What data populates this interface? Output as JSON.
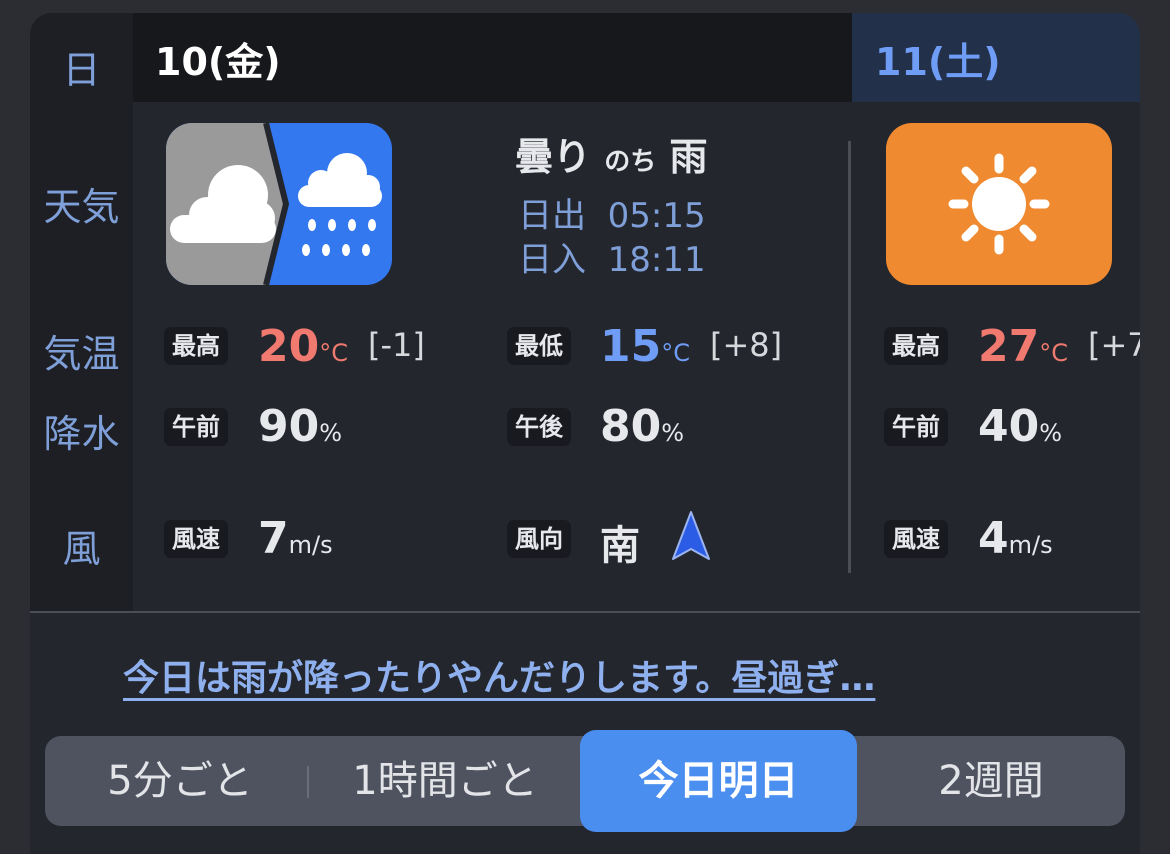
{
  "labels": {
    "day": "日",
    "weather": "天気",
    "temp": "気温",
    "precip": "降水",
    "wind": "風"
  },
  "days": [
    {
      "date": "10(金)",
      "weather_icon": "cloud-then-rain-icon",
      "forecast": {
        "first": "曇り",
        "then": "のち",
        "second": "雨"
      },
      "sunrise_label": "日出",
      "sunrise": "05:15",
      "sunset_label": "日入",
      "sunset": "18:11",
      "high_label": "最高",
      "high": "20",
      "high_unit": "°C",
      "high_diff": "[-1]",
      "low_label": "最低",
      "low": "15",
      "low_unit": "°C",
      "low_diff": "[+8]",
      "am_label": "午前",
      "am_precip": "90",
      "pm_label": "午後",
      "pm_precip": "80",
      "precip_unit": "%",
      "wind_speed_label": "風速",
      "wind_speed": "7",
      "wind_unit": "m/s",
      "wind_dir_label": "風向",
      "wind_dir": "南"
    },
    {
      "date": "11(土)",
      "weather_icon": "sun-icon",
      "high_label": "最高",
      "high": "27",
      "high_unit": "°C",
      "high_diff": "[+7",
      "am_label": "午前",
      "am_precip": "40",
      "precip_unit": "%",
      "wind_speed_label": "風速",
      "wind_speed": "4",
      "wind_unit": "m/s"
    }
  ],
  "summary_link": "今日は雨が降ったりやんだりします。昼過ぎ…",
  "tabs": [
    "5分ごと",
    "1時間ごと",
    "今日明日",
    "2週間"
  ],
  "active_tab": "今日明日",
  "colors": {
    "high": "#f07a6f",
    "low": "#6f9cf5",
    "accent": "#4a8ef0",
    "sun_tile": "#f08a30"
  }
}
